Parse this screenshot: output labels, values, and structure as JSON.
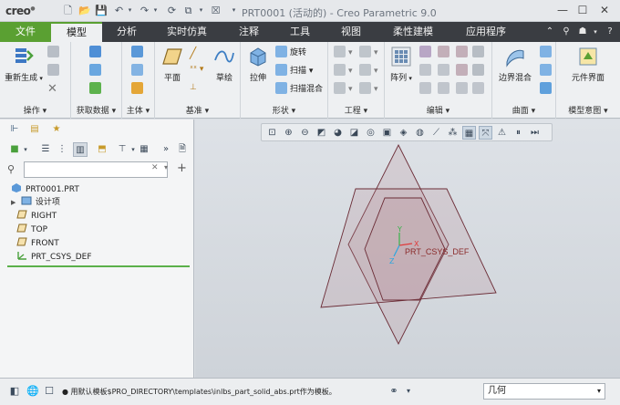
{
  "app": {
    "logo": "creo",
    "title": "PRT0001 (活动的) - Creo Parametric 9.0"
  },
  "tabs": [
    {
      "label": "文件"
    },
    {
      "label": "模型"
    },
    {
      "label": "分析"
    },
    {
      "label": "实时仿真"
    },
    {
      "label": "注释"
    },
    {
      "label": "工具"
    },
    {
      "label": "视图"
    },
    {
      "label": "柔性建模"
    },
    {
      "label": "应用程序"
    }
  ],
  "ribbon": {
    "groups": [
      {
        "label": "操作",
        "buttons": [
          "重新生成"
        ]
      },
      {
        "label": "获取数据"
      },
      {
        "label": "主体"
      },
      {
        "label": "基准",
        "buttons": [
          "平面",
          "草绘"
        ]
      },
      {
        "label": "形状",
        "buttons": [
          "拉伸",
          "旋转",
          "扫描",
          "扫描混合"
        ]
      },
      {
        "label": "工程"
      },
      {
        "label": "编辑",
        "buttons": [
          "阵列"
        ]
      },
      {
        "label": "曲面",
        "buttons": [
          "边界混合"
        ]
      },
      {
        "label": "模型意图",
        "buttons": [
          "元件界面"
        ]
      }
    ]
  },
  "model_tree": {
    "filter_placeholder": "",
    "items": [
      {
        "label": "PRT0001.PRT",
        "icon": "part-icon"
      },
      {
        "label": "设计项",
        "icon": "design-items-icon",
        "expandable": true
      },
      {
        "label": "RIGHT",
        "icon": "datum-plane-icon"
      },
      {
        "label": "TOP",
        "icon": "datum-plane-icon"
      },
      {
        "label": "FRONT",
        "icon": "datum-plane-icon"
      },
      {
        "label": "PRT_CSYS_DEF",
        "icon": "csys-icon"
      }
    ]
  },
  "graphics": {
    "csys_label": "PRT_CSYS_DEF",
    "axis_x": "X",
    "axis_y": "Y",
    "axis_z": "Z"
  },
  "status": {
    "message": "● 用默认模板$PRO_DIRECTORY\\templates\\inlbs_part_solid_abs.prt作为模板。",
    "filter_value": "几何"
  },
  "colors": {
    "file_tab": "#5aa032",
    "tabbar": "#3a3d42",
    "plane_fill": "#b48a92",
    "plane_edge": "#6b2c36"
  }
}
